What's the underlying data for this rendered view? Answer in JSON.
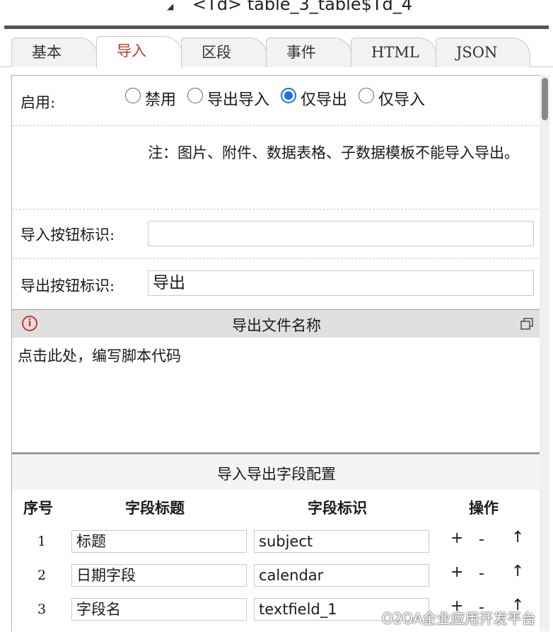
{
  "header": {
    "element_name": "<Td> table_3_table$Td_4"
  },
  "tabs": [
    {
      "label": "基本"
    },
    {
      "label": "导入"
    },
    {
      "label": "区段"
    },
    {
      "label": "事件"
    },
    {
      "label": "HTML"
    },
    {
      "label": "JSON"
    }
  ],
  "enable": {
    "label": "启用:",
    "options": [
      "禁用",
      "导出导入",
      "仅导出",
      "仅导入"
    ],
    "selected": "仅导出"
  },
  "note": "注：图片、附件、数据表格、子数据模板不能导入导出。",
  "import_button": {
    "label": "导入按钮标识:",
    "value": ""
  },
  "export_button": {
    "label": "导出按钮标识:",
    "value": "导出"
  },
  "script": {
    "title": "导出文件名称",
    "hint": "点击此处，编写脚本代码"
  },
  "field_config": {
    "title": "导入导出字段配置",
    "columns": [
      "序号",
      "字段标题",
      "字段标识",
      "操作"
    ],
    "rows": [
      {
        "no": "1",
        "title": "标题",
        "id": "subject"
      },
      {
        "no": "2",
        "title": "日期字段",
        "id": "calendar"
      },
      {
        "no": "3",
        "title": "字段名",
        "id": "textfield_1"
      }
    ],
    "ops": [
      "+",
      "-",
      "↑"
    ]
  },
  "watermark": "O2OA企业应用开发平台",
  "colors": {
    "accent": "#1a73e8",
    "active_tab": "#c0392b",
    "info": "#d63030"
  }
}
